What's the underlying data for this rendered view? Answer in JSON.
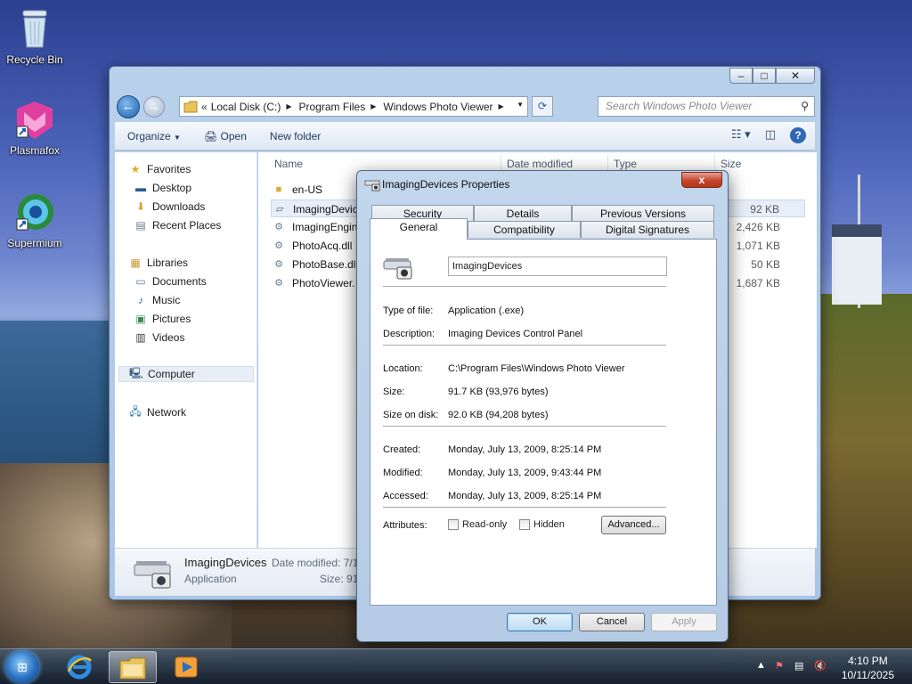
{
  "desktop": {
    "icons": [
      {
        "label": "Recycle Bin"
      },
      {
        "label": "Plasmafox"
      },
      {
        "label": "Supermium"
      }
    ]
  },
  "explorer": {
    "address": {
      "crumbs": [
        "Local Disk (C:)",
        "Program Files",
        "Windows Photo Viewer"
      ],
      "overflow": "«"
    },
    "search_placeholder": "Search Windows Photo Viewer",
    "toolbar": {
      "organize": "Organize",
      "open": "Open",
      "new_folder": "New folder"
    },
    "nav": {
      "favorites": "Favorites",
      "desktop": "Desktop",
      "downloads": "Downloads",
      "recent": "Recent Places",
      "libraries": "Libraries",
      "documents": "Documents",
      "music": "Music",
      "pictures": "Pictures",
      "videos": "Videos",
      "computer": "Computer",
      "network": "Network"
    },
    "columns": {
      "name": "Name",
      "date_modified": "Date modified",
      "type": "Type",
      "size": "Size"
    },
    "files": [
      {
        "name": "en-US",
        "size": ""
      },
      {
        "name": "ImagingDevic",
        "size": "92 KB"
      },
      {
        "name": "ImagingEngin",
        "size": "2,426 KB"
      },
      {
        "name": "PhotoAcq.dll",
        "size": "1,071 KB"
      },
      {
        "name": "PhotoBase.dll",
        "size": "50 KB"
      },
      {
        "name": "PhotoViewer.",
        "size": "1,687 KB"
      }
    ],
    "details_pane": {
      "name": "ImagingDevices",
      "type": "Application",
      "date_label": "Date modified: 7/1",
      "size_label": "Size: 91"
    }
  },
  "dialog": {
    "title": "ImagingDevices Properties",
    "close_label": "x",
    "tabs": {
      "security": "Security",
      "details": "Details",
      "previous_versions": "Previous Versions",
      "general": "General",
      "compatibility": "Compatibility",
      "digital_signatures": "Digital Signatures"
    },
    "name_value": "ImagingDevices",
    "labels": {
      "type": "Type of file:",
      "description": "Description:",
      "location": "Location:",
      "size": "Size:",
      "size_on_disk": "Size on disk:",
      "created": "Created:",
      "modified": "Modified:",
      "accessed": "Accessed:",
      "attributes": "Attributes:"
    },
    "values": {
      "type": "Application (.exe)",
      "description": "Imaging Devices Control Panel",
      "location": "C:\\Program Files\\Windows Photo Viewer",
      "size": "91.7 KB (93,976 bytes)",
      "size_on_disk": "92.0 KB (94,208 bytes)",
      "created": "Monday, July 13, 2009, 8:25:14 PM",
      "modified": "Monday, July 13, 2009, 9:43:44 PM",
      "accessed": "Monday, July 13, 2009, 8:25:14 PM"
    },
    "attributes": {
      "read_only": "Read-only",
      "hidden": "Hidden",
      "advanced": "Advanced..."
    },
    "buttons": {
      "ok": "OK",
      "cancel": "Cancel",
      "apply": "Apply"
    }
  },
  "taskbar": {
    "time": "4:10 PM",
    "date": "10/11/2025"
  }
}
